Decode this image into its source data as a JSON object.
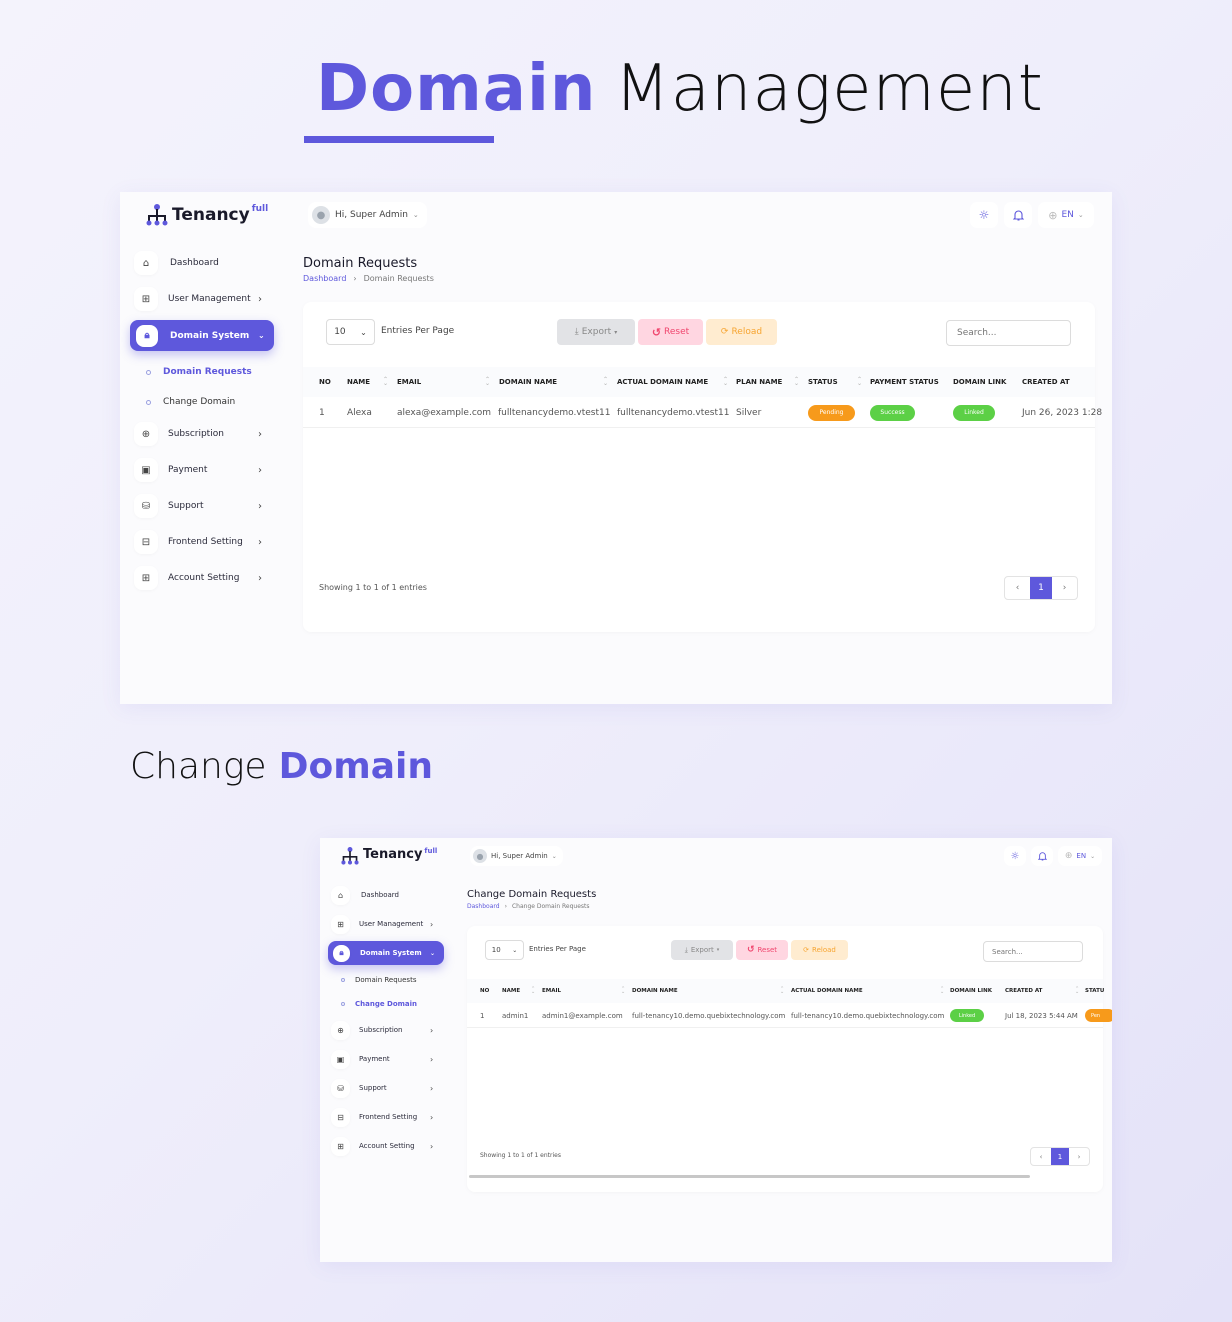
{
  "hero": {
    "accent": "Domain",
    "rest": "Management"
  },
  "section2": {
    "rest": "Change",
    "accent": "Domain"
  },
  "shared": {
    "logo_text": "Tenancy",
    "logo_sup": "full",
    "greeting": "Hi, Super Admin",
    "language": "EN",
    "nav": [
      {
        "label": "Dashboard",
        "icon": "home-icon"
      },
      {
        "label": "User Management",
        "icon": "grid-icon"
      },
      {
        "label": "Domain System",
        "icon": "lock-icon"
      },
      {
        "label": "Subscription",
        "icon": "gift-icon"
      },
      {
        "label": "Payment",
        "icon": "clipboard-icon"
      },
      {
        "label": "Support",
        "icon": "database-icon"
      },
      {
        "label": "Frontend Setting",
        "icon": "layout-icon"
      },
      {
        "label": "Account Setting",
        "icon": "apps-add-icon"
      }
    ],
    "subnav": [
      "Domain Requests",
      "Change Domain"
    ],
    "entries_value": "10",
    "entries_label": "Entries Per Page",
    "export": "Export",
    "reset": "Reset",
    "reload": "Reload",
    "search_placeholder": "Search...",
    "showing": "Showing 1 to 1 of 1 entries",
    "page": "1"
  },
  "screen1": {
    "title": "Domain Requests",
    "crumb_home": "Dashboard",
    "crumb_current": "Domain Requests",
    "columns": [
      "NO",
      "NAME",
      "EMAIL",
      "DOMAIN NAME",
      "ACTUAL DOMAIN NAME",
      "PLAN NAME",
      "STATUS",
      "PAYMENT STATUS",
      "DOMAIN LINK",
      "CREATED AT"
    ],
    "rows": [
      {
        "no": "1",
        "name": "Alexa",
        "email": "alexa@example.com",
        "domain": "fulltenancydemo.vtest11",
        "actual": "fulltenancydemo.vtest11",
        "plan": "Silver",
        "status": "Pending",
        "payment": "Success",
        "link": "Linked",
        "created": "Jun 26, 2023 1:28"
      }
    ]
  },
  "screen2": {
    "title": "Change Domain Requests",
    "crumb_home": "Dashboard",
    "crumb_current": "Change Domain Requests",
    "columns": [
      "NO",
      "NAME",
      "EMAIL",
      "DOMAIN NAME",
      "ACTUAL DOMAIN NAME",
      "DOMAIN LINK",
      "CREATED AT",
      "STATU"
    ],
    "rows": [
      {
        "no": "1",
        "name": "admin1",
        "email": "admin1@example.com",
        "domain": "full-tenancy10.demo.quebixtechnology.com",
        "actual": "full-tenancy10.demo.quebixtechnology.com",
        "link": "Linked",
        "created": "Jul 18, 2023 5:44 AM",
        "status": "Pen"
      }
    ]
  },
  "colors": {
    "accent": "#5e58dc",
    "pending": "#f79a1b",
    "success": "#5cd046",
    "reset": "#f0466e",
    "reload": "#f7a531"
  }
}
